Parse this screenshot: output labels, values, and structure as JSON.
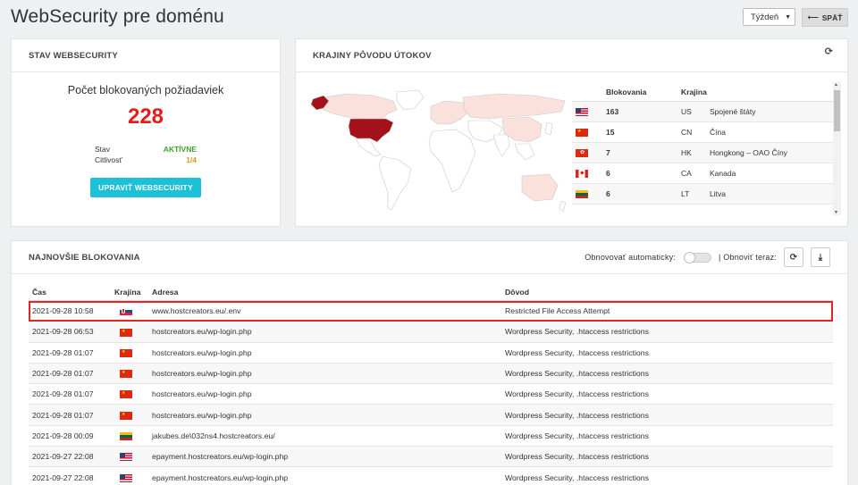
{
  "page": {
    "title": "WebSecurity pre doménu",
    "period_select": "Týždeň",
    "back_label": "SPÄŤ"
  },
  "status_card": {
    "title": "STAV WEBSECURITY",
    "blocked_label": "Počet blokovaných požiadaviek",
    "blocked_count": "228",
    "state_label": "Stav",
    "state_value": "AKTÍVNE",
    "sensitivity_label": "Citlivosť",
    "sensitivity_value": "1/4",
    "edit_button": "UPRAVIŤ WEBSECURITY",
    "colors": {
      "active": "#3ba52b",
      "sensitivity": "#d79a1f",
      "count": "#e41c1c",
      "button": "#1cc1d8"
    }
  },
  "countries_card": {
    "title": "KRAJINY PÔVODU ÚTOKOV",
    "refresh_icon": "refresh-icon",
    "columns": {
      "blocked": "Blokovania",
      "country": "Krajina"
    },
    "rows": [
      {
        "flag": "us",
        "count": "163",
        "code": "US",
        "name": "Spojené štáty"
      },
      {
        "flag": "cn",
        "count": "15",
        "code": "CN",
        "name": "Čína"
      },
      {
        "flag": "hk",
        "count": "7",
        "code": "HK",
        "name": "Hongkong – OAO Číny"
      },
      {
        "flag": "ca",
        "count": "6",
        "code": "CA",
        "name": "Kanada"
      },
      {
        "flag": "lt",
        "count": "6",
        "code": "LT",
        "name": "Litva"
      }
    ],
    "map_colors": {
      "high": "#a3121b",
      "low": "#fbe1dc",
      "none": "#ffffff",
      "border": "#c9c9c9"
    }
  },
  "recent_card": {
    "title": "NAJNOVŠIE BLOKOVANIA",
    "auto_refresh_label": "Obnovovať automaticky:",
    "refresh_now_label": "| Obnoviť teraz:",
    "columns": {
      "time": "Čas",
      "country": "Krajina",
      "address": "Adresa",
      "reason": "Dôvod"
    },
    "rows": [
      {
        "time": "2021-09-28 10:58",
        "flag": "sk",
        "address": "www.hostcreators.eu/.env",
        "reason": "Restricted File Access Attempt",
        "highlight": true
      },
      {
        "time": "2021-09-28 06:53",
        "flag": "cn",
        "address": "hostcreators.eu/wp-login.php",
        "reason": "Wordpress Security, .htaccess restrictions"
      },
      {
        "time": "2021-09-28 01:07",
        "flag": "cn",
        "address": "hostcreators.eu/wp-login.php",
        "reason": "Wordpress Security, .htaccess restrictions"
      },
      {
        "time": "2021-09-28 01:07",
        "flag": "cn",
        "address": "hostcreators.eu/wp-login.php",
        "reason": "Wordpress Security, .htaccess restrictions"
      },
      {
        "time": "2021-09-28 01:07",
        "flag": "cn",
        "address": "hostcreators.eu/wp-login.php",
        "reason": "Wordpress Security, .htaccess restrictions"
      },
      {
        "time": "2021-09-28 01:07",
        "flag": "cn",
        "address": "hostcreators.eu/wp-login.php",
        "reason": "Wordpress Security, .htaccess restrictions"
      },
      {
        "time": "2021-09-28 00:09",
        "flag": "lt",
        "address": "jakubes.de\\032ns4.hostcreators.eu/",
        "reason": "Wordpress Security, .htaccess restrictions"
      },
      {
        "time": "2021-09-27 22:08",
        "flag": "us",
        "address": "epayment.hostcreators.eu/wp-login.php",
        "reason": "Wordpress Security, .htaccess restrictions"
      },
      {
        "time": "2021-09-27 22:08",
        "flag": "us",
        "address": "epayment.hostcreators.eu/wp-login.php",
        "reason": "Wordpress Security, .htaccess restrictions"
      }
    ],
    "highlight_color": "#e22525"
  }
}
